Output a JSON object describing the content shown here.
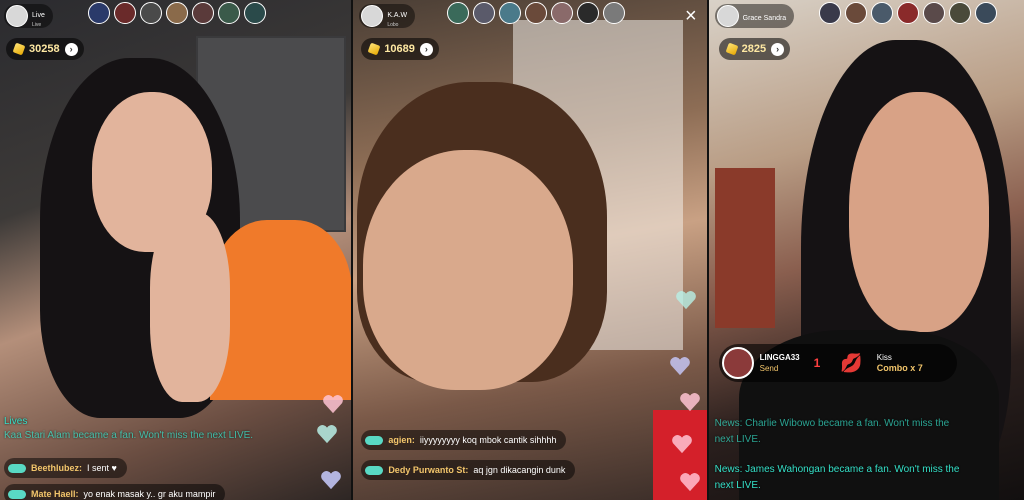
{
  "panels": [
    {
      "host": {
        "name": "Live",
        "sub": "Live"
      },
      "coins": "30258",
      "viewer_colors": [
        "#2a3a6a",
        "#6a2a2a",
        "#4a4a4a",
        "#8a6a4a",
        "#5a3a3a",
        "#3a5a4a",
        "#2a4a4a"
      ],
      "chats": [
        {
          "user": "Beethlubez:",
          "text": "I sent ♥"
        },
        {
          "user": "Mate Haell:",
          "text": "yo enak masak y.. gr aku mampir"
        }
      ],
      "system": [
        "Lives",
        "Kaa Stari Alam became a fan. Won't miss the next LIVE."
      ]
    },
    {
      "host": {
        "name": "K.A.W",
        "sub": "Lobo"
      },
      "coins": "10689",
      "viewer_colors": [
        "#3a6a5a",
        "#5a5a6a",
        "#4a7a8a",
        "#6a4a3a",
        "#8a6a6a",
        "#2a2a2a",
        "#7a7a7a"
      ],
      "chats": [
        {
          "user": "agien:",
          "text": "iiyyyyyyyy koq mbok cantik sihhhh"
        },
        {
          "user": "Dedy Purwanto St:",
          "text": "aq jgn dikacangin dunk"
        }
      ],
      "close_icon": "×"
    },
    {
      "host": {
        "name": "Grace Sandra",
        "sub": ""
      },
      "coins": "2825",
      "viewer_colors": [
        "#3a3a4a",
        "#6a4a3a",
        "#4a5a6a",
        "#8a2a2a",
        "#5a4a4a",
        "#4a4a3a",
        "#3a4a5a"
      ],
      "gift": {
        "user": "LINGGA33",
        "action": "Send",
        "count": "1",
        "icon": "lips-icon",
        "gift_name": "Kiss",
        "combo": "Combo x 7"
      },
      "system": [
        "News: Charlie Wibowo became a fan. Won't miss the",
        "next LIVE.",
        "News: James Wahongan became a fan. Won't miss the",
        "next LIVE."
      ]
    }
  ],
  "colors": {
    "accent_teal": "#35e0c8",
    "coin_gold": "#ffe9a3",
    "username_gold": "#f2c56b",
    "heart_pink": "#ffb6c8"
  }
}
